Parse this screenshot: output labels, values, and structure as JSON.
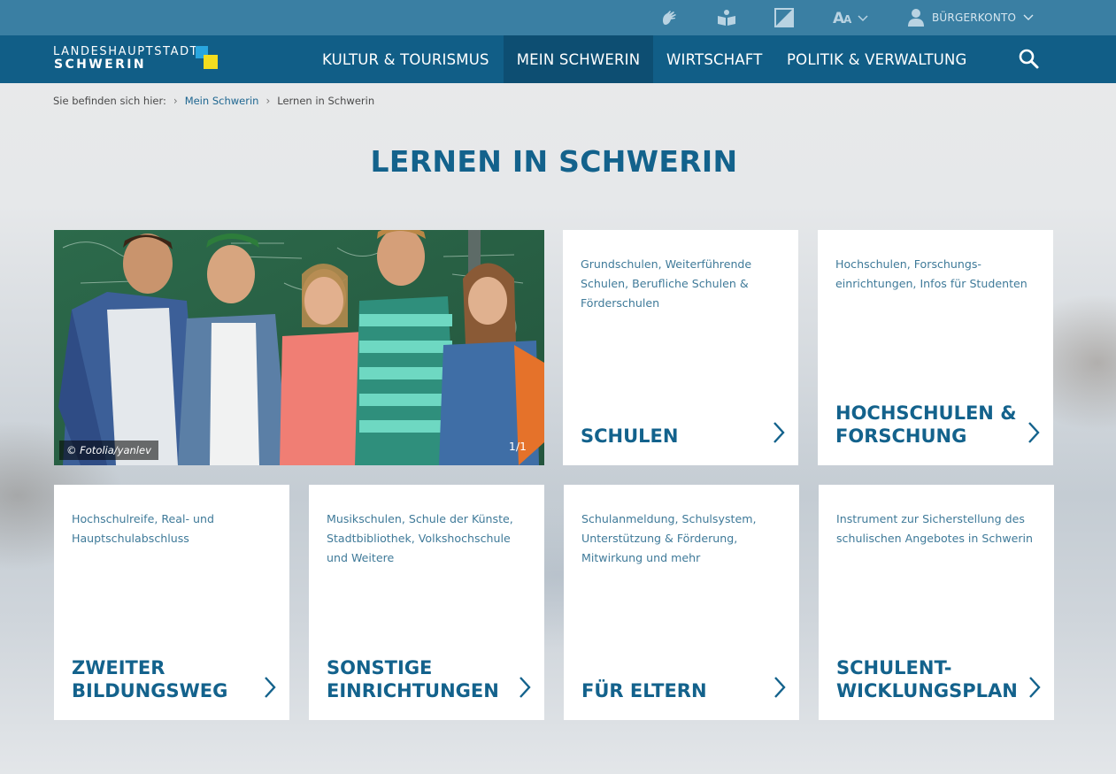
{
  "utility": {
    "account_label": "BÜRGERKONTO",
    "icons": [
      "sign-language-icon",
      "easy-language-icon",
      "contrast-icon",
      "font-size-icon",
      "user-icon"
    ]
  },
  "logo": {
    "top": "LANDESHAUPTSTADT",
    "bottom": "SCHWERIN"
  },
  "nav": {
    "items": [
      {
        "label": "KULTUR & TOURISMUS"
      },
      {
        "label": "MEIN SCHWERIN"
      },
      {
        "label": "WIRTSCHAFT"
      },
      {
        "label": "POLITIK & VERWALTUNG"
      }
    ],
    "active": "MEIN SCHWERIN"
  },
  "breadcrumb": {
    "prefix": "Sie befinden sich hier:",
    "items": [
      {
        "label": "Mein Schwerin"
      },
      {
        "label": "Lernen in Schwerin"
      }
    ]
  },
  "page": {
    "title": "LERNEN IN SCHWERIN"
  },
  "hero": {
    "credit": "© Fotolia/yanlev",
    "counter": "1/1"
  },
  "tiles": [
    {
      "desc": "Grundschulen, Weiterführende Schulen, Berufliche Schulen & Förderschulen",
      "title": "SCHULEN"
    },
    {
      "desc": "Hochschulen, Forschungs-einrichtungen, Infos für Studenten",
      "title": "HOCHSCHULEN & FORSCHUNG"
    },
    {
      "desc": "Hochschulreife, Real- und Hauptschulabschluss",
      "title": "ZWEITER BILDUNGSWEG"
    },
    {
      "desc": "Musikschulen, Schule der Künste, Stadtbibliothek, Volkshochschule und Weitere",
      "title": "SONSTIGE EINRICHTUNGEN"
    },
    {
      "desc": "Schulanmeldung, Schulsystem, Unterstützung & Förderung, Mitwirkung und mehr",
      "title": "FÜR ELTERN"
    },
    {
      "desc": "Instrument zur Sicherstellung des schulischen Angebotes in Schwerin",
      "title": "SCHULENT-WICKLUNGSPLAN"
    }
  ],
  "colors": {
    "utility_bar": "#3a7fa3",
    "nav_bar": "#115e87",
    "nav_active": "#0d4e72",
    "accent_text": "#13628c"
  }
}
